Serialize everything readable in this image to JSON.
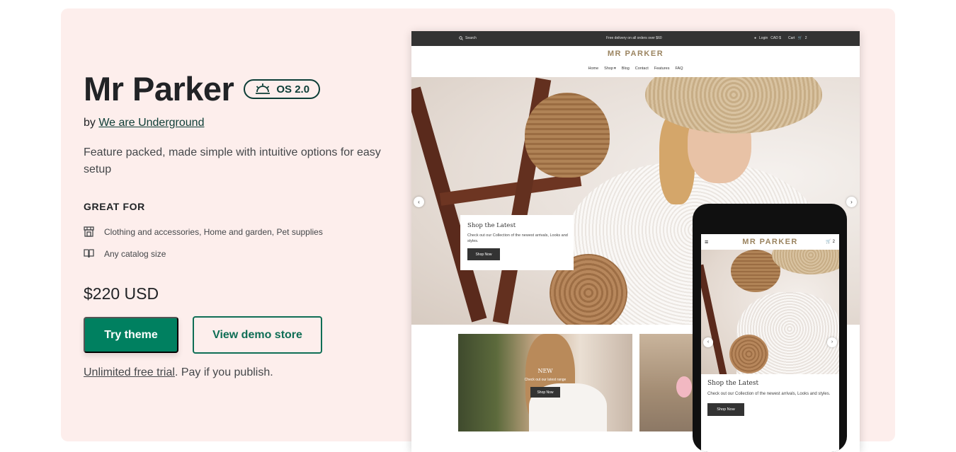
{
  "theme": {
    "title": "Mr Parker",
    "os_badge": "OS 2.0",
    "by_prefix": "by ",
    "author": "We are Underground",
    "description": "Feature packed, made simple with intuitive options for easy setup",
    "great_for_heading": "GREAT FOR",
    "features": [
      {
        "icon": "store-icon",
        "text": "Clothing and accessories, Home and garden, Pet supplies"
      },
      {
        "icon": "catalog-icon",
        "text": "Any catalog size"
      }
    ],
    "price": "$220 USD",
    "try_button": "Try theme",
    "demo_button": "View demo store",
    "trial_link": "Unlimited free trial",
    "trial_suffix": ". Pay if you publish."
  },
  "preview": {
    "topbar": {
      "search": "Search",
      "promo": "Free delivery on all orders over $60",
      "login": "Login",
      "currency": "CAD $",
      "cart": "Cart",
      "cart_count": "2"
    },
    "logo": "MR PARKER",
    "nav": [
      "Home",
      "Shop",
      "Blog",
      "Contact",
      "Features",
      "FAQ"
    ],
    "hero_box": {
      "title": "Shop the Latest",
      "text": "Check out our Collection of the newest arrivals, Looks and styles.",
      "button": "Shop Now"
    },
    "tile": {
      "title": "NEW",
      "subtitle": "Check out our latest range",
      "button": "Shop Now"
    }
  },
  "mobile": {
    "logo": "MR PARKER",
    "cart_count": "2",
    "box_title": "Shop the Latest",
    "box_text": "Check out our Collection of the newest arrivals, Looks and styles.",
    "box_button": "Shop Now"
  },
  "colors": {
    "card_background": "#fdeeec",
    "primary": "#008060",
    "dark_green": "#0c3d36",
    "logo_gold": "#9b8460"
  }
}
